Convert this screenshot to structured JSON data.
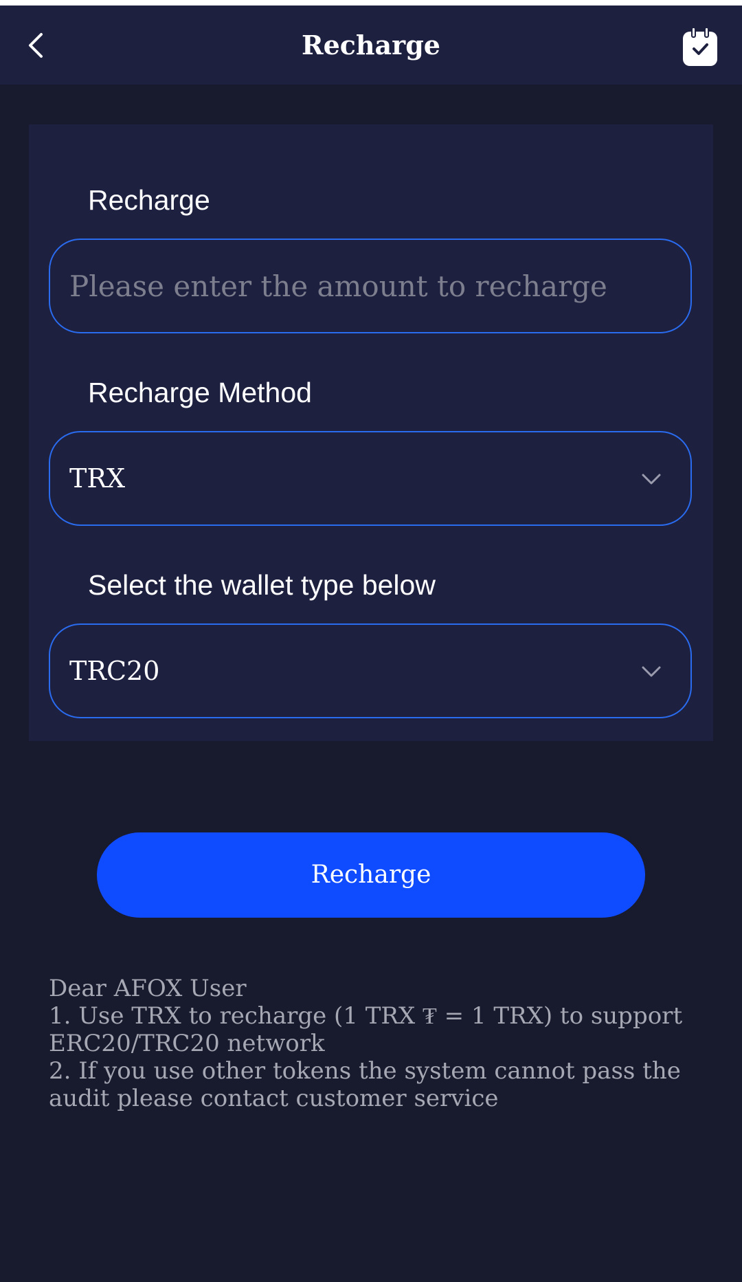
{
  "header": {
    "title": "Recharge",
    "back_icon": "chevron-left-icon",
    "calendar_icon": "calendar-check-icon"
  },
  "form": {
    "amount": {
      "label": "Recharge",
      "placeholder": "Please enter the amount to recharge",
      "value": ""
    },
    "method": {
      "label": "Recharge Method",
      "selected": "TRX"
    },
    "wallet_type": {
      "label": "Select the wallet type below",
      "selected": "TRC20"
    }
  },
  "submit_label": "Recharge",
  "notice": {
    "greeting": "Dear AFOX User",
    "line1": "1. Use TRX to recharge (1 TRX ₮ = 1 TRX) to support ERC20/TRC20 network",
    "line2": "2. If you use other tokens the system cannot pass the audit please contact customer service"
  },
  "colors": {
    "background": "#181a2e",
    "panel": "#1e2040",
    "accent": "#0f4bff",
    "border": "#2a6cf0"
  }
}
